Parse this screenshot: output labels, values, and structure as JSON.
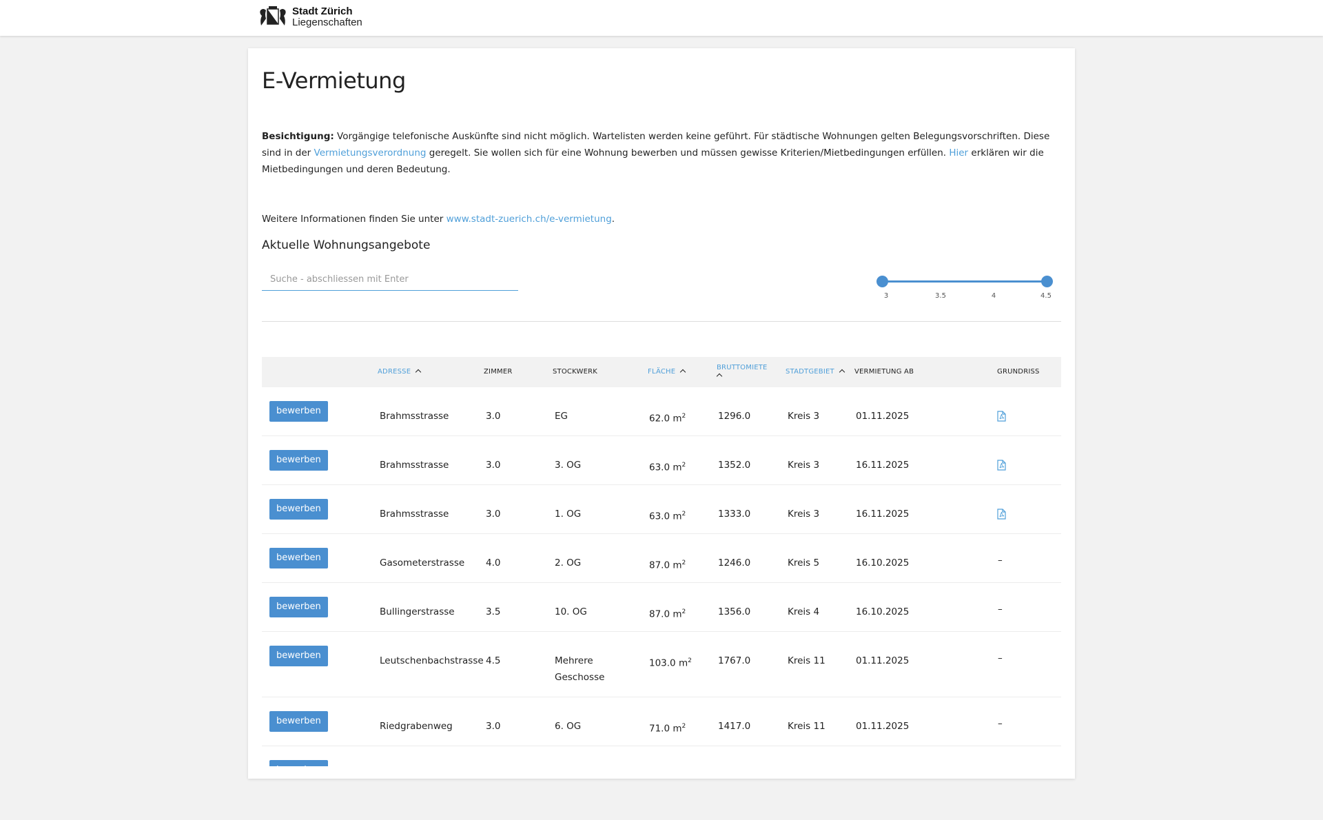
{
  "header": {
    "logo_title": "Stadt Zürich",
    "logo_subtitle": "Liegenschaften"
  },
  "page": {
    "title": "E-Vermietung",
    "intro_label": "Besichtigung:",
    "intro_text_1": " Vorgängige telefonische Auskünfte sind nicht möglich. Wartelisten werden keine geführt. Für städtische Wohnungen gelten Belegungsvorschriften. Diese sind in der ",
    "intro_link_1": "Vermietungsverordnung",
    "intro_text_2": " geregelt. Sie wollen sich für eine Wohnung bewerben und müssen gewisse Kriterien/Mietbedingungen erfüllen. ",
    "intro_link_2": "Hier",
    "intro_text_3": " erklären wir die Mietbedingungen und deren Bedeutung.",
    "more_info_text": "Weitere Informationen finden Sie unter ",
    "more_info_link": "www.stadt-zuerich.ch/e-vermietung",
    "more_info_end": ".",
    "section_title": "Aktuelle Wohnungsangebote"
  },
  "search": {
    "placeholder": "Suche - abschliessen mit Enter",
    "value": ""
  },
  "slider": {
    "ticks": [
      "3",
      "3.5",
      "4",
      "4.5"
    ],
    "range_min": 3,
    "range_max": 4.5,
    "selected_low": 3,
    "selected_high": 4.5
  },
  "table": {
    "headers": {
      "adresse": "Adresse",
      "zimmer": "Zimmer",
      "stockwerk": "Stockwerk",
      "flaeche": "Fläche",
      "bruttomiete": "Bruttomiete",
      "stadtgebiet": "Stadtgebiet",
      "vermietung_ab": "Vermietung ab",
      "grundriss": "Grundriss"
    },
    "button_label": "bewerben",
    "area_unit": "m",
    "rows": [
      {
        "adresse": "Brahmsstrasse",
        "zimmer": "3.0",
        "stockwerk": "EG",
        "flaeche": "62.0",
        "miete": "1296.0",
        "gebiet": "Kreis 3",
        "ab": "01.11.2025",
        "grundriss": "pdf"
      },
      {
        "adresse": "Brahmsstrasse",
        "zimmer": "3.0",
        "stockwerk": "3. OG",
        "flaeche": "63.0",
        "miete": "1352.0",
        "gebiet": "Kreis 3",
        "ab": "16.11.2025",
        "grundriss": "pdf"
      },
      {
        "adresse": "Brahmsstrasse",
        "zimmer": "3.0",
        "stockwerk": "1. OG",
        "flaeche": "63.0",
        "miete": "1333.0",
        "gebiet": "Kreis 3",
        "ab": "16.11.2025",
        "grundriss": "pdf"
      },
      {
        "adresse": "Gasometerstrasse",
        "zimmer": "4.0",
        "stockwerk": "2. OG",
        "flaeche": "87.0",
        "miete": "1246.0",
        "gebiet": "Kreis 5",
        "ab": "16.10.2025",
        "grundriss": "–"
      },
      {
        "adresse": "Bullingerstrasse",
        "zimmer": "3.5",
        "stockwerk": "10. OG",
        "flaeche": "87.0",
        "miete": "1356.0",
        "gebiet": "Kreis 4",
        "ab": "16.10.2025",
        "grundriss": "–"
      },
      {
        "adresse": "Leutschenbachstrasse",
        "zimmer": "4.5",
        "stockwerk": "Mehrere Geschosse",
        "flaeche": "103.0",
        "miete": "1767.0",
        "gebiet": "Kreis 11",
        "ab": "01.11.2025",
        "grundriss": "–"
      },
      {
        "adresse": "Riedgrabenweg",
        "zimmer": "3.0",
        "stockwerk": "6. OG",
        "flaeche": "71.0",
        "miete": "1417.0",
        "gebiet": "Kreis 11",
        "ab": "01.11.2025",
        "grundriss": "–"
      }
    ]
  },
  "colors": {
    "accent": "#4a8fd0",
    "link": "#4f9fd9",
    "background": "#f2f2f2"
  }
}
